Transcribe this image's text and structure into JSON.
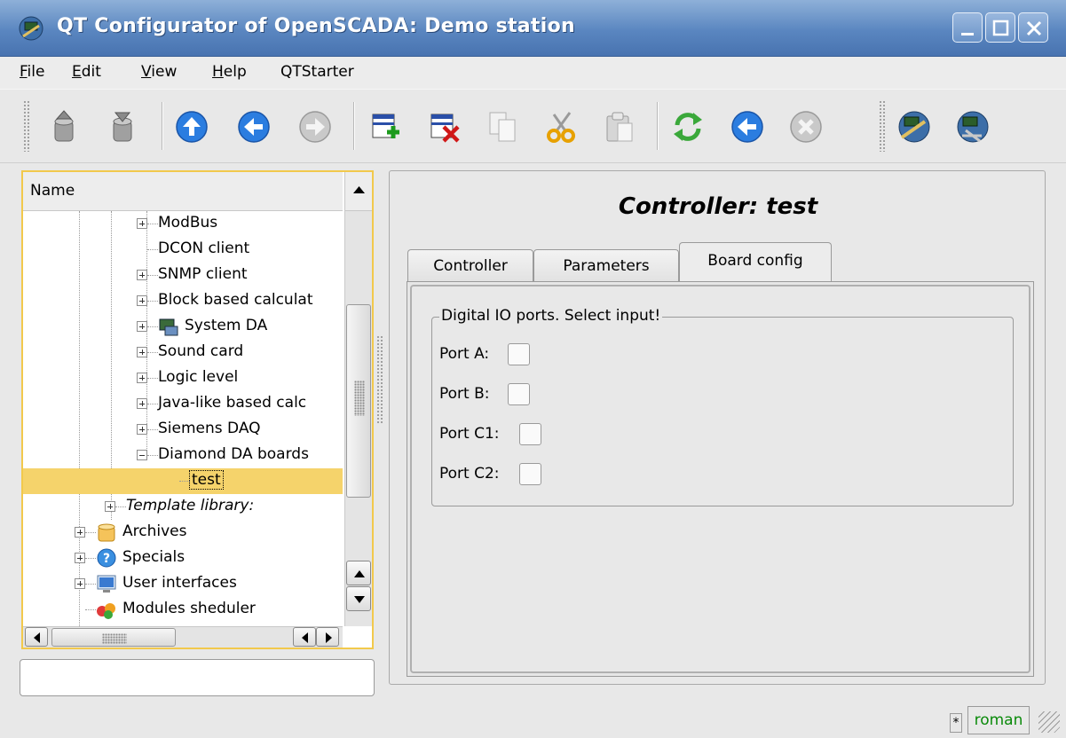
{
  "window": {
    "title": "QT Configurator of OpenSCADA: Demo station"
  },
  "menu": [
    {
      "key": "F",
      "rest": "ile"
    },
    {
      "key": "E",
      "rest": "dit"
    },
    {
      "key": "V",
      "rest": "iew"
    },
    {
      "key": "H",
      "rest": "elp"
    },
    {
      "key": "",
      "rest": "QTStarter"
    }
  ],
  "toolbar": {
    "icons": [
      "db-load-icon",
      "db-save-icon",
      "up-icon",
      "back-icon",
      "forward-icon",
      "add-item-icon",
      "delete-item-icon",
      "copy-icon",
      "cut-icon",
      "paste-icon",
      "refresh-icon",
      "back-circle-icon",
      "stop-icon",
      "station-icon",
      "config-icon"
    ]
  },
  "tree": {
    "header": "Name",
    "items": [
      {
        "label": "ModBus",
        "level": 3,
        "expander": "plus",
        "icon": null
      },
      {
        "label": "DCON client",
        "level": 3,
        "expander": null,
        "icon": null
      },
      {
        "label": "SNMP client",
        "level": 3,
        "expander": "plus",
        "icon": null
      },
      {
        "label": "Block based calculat",
        "level": 3,
        "expander": "plus",
        "icon": null
      },
      {
        "label": "System DA",
        "level": 3,
        "expander": "plus",
        "icon": "system-da-icon"
      },
      {
        "label": "Sound card",
        "level": 3,
        "expander": "plus",
        "icon": null
      },
      {
        "label": "Logic level",
        "level": 3,
        "expander": "plus",
        "icon": null
      },
      {
        "label": "Java-like based calc",
        "level": 3,
        "expander": "plus",
        "icon": null
      },
      {
        "label": "Siemens DAQ",
        "level": 3,
        "expander": "plus",
        "icon": null
      },
      {
        "label": "Diamond DA boards",
        "level": 3,
        "expander": "minus",
        "icon": null
      },
      {
        "label": "test",
        "level": 4,
        "expander": null,
        "icon": null,
        "selected": true
      },
      {
        "label": "Template library:",
        "level": 2,
        "expander": "plus",
        "icon": null,
        "italic": true
      },
      {
        "label": "Archives",
        "level": 1,
        "expander": "plus",
        "icon": "archives-icon"
      },
      {
        "label": "Specials",
        "level": 1,
        "expander": "plus",
        "icon": "specials-icon"
      },
      {
        "label": "User interfaces",
        "level": 1,
        "expander": "plus",
        "icon": "user-interfaces-icon"
      },
      {
        "label": "Modules sheduler",
        "level": 1,
        "expander": null,
        "icon": "modules-sheduler-icon"
      }
    ]
  },
  "main": {
    "title": "Controller: test",
    "tabs": [
      {
        "label": "Controller",
        "active": false
      },
      {
        "label": "Parameters",
        "active": false
      },
      {
        "label": "Board config",
        "active": true
      }
    ],
    "group_title": "Digital IO ports. Select input!",
    "ports": [
      {
        "label": "Port A:",
        "checked": false
      },
      {
        "label": "Port B:",
        "checked": false
      },
      {
        "label": "Port C1:",
        "checked": false
      },
      {
        "label": "Port C2:",
        "checked": false
      }
    ]
  },
  "status": {
    "modified": "*",
    "user": "roman"
  }
}
